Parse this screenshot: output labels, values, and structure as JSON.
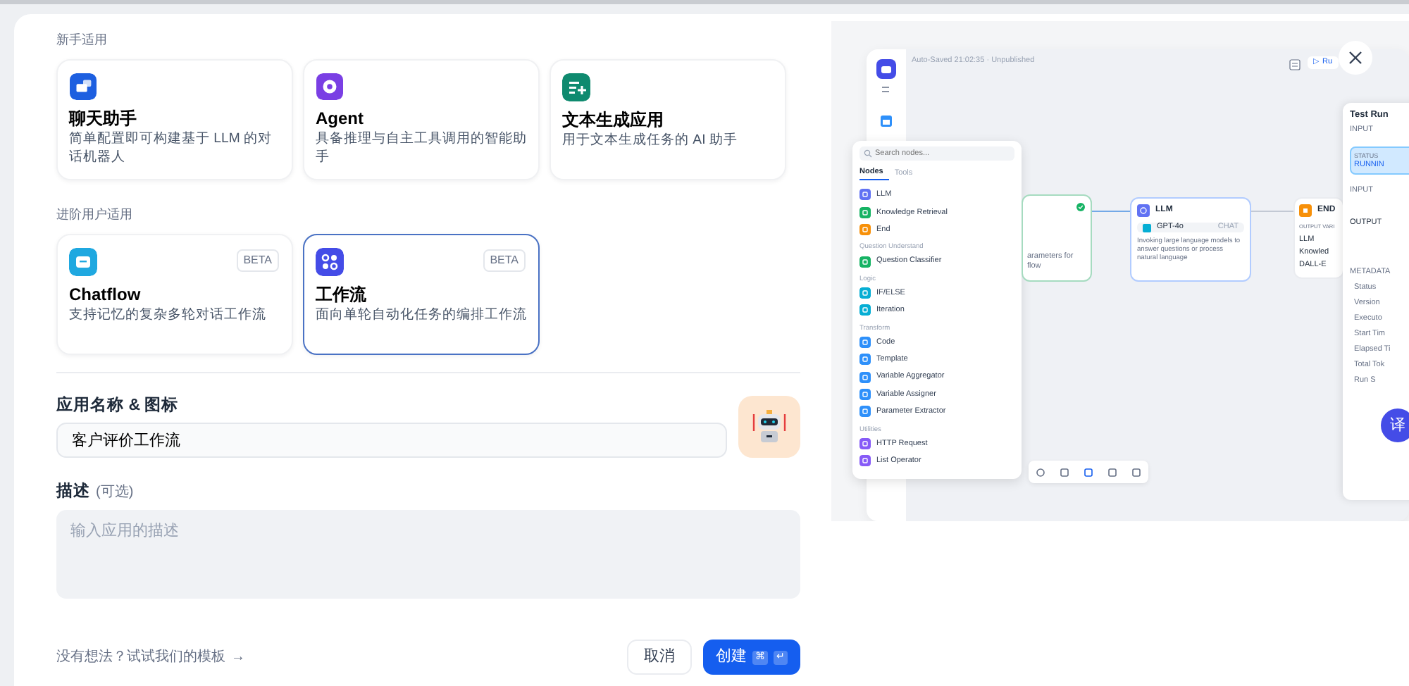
{
  "sections": [
    {
      "label": "新手适用",
      "apps": [
        {
          "title": "聊天助手",
          "description": "简单配置即可构建基于 LLM 的对话机器人",
          "color": "#1d5fe0",
          "selected": false
        },
        {
          "title": "Agent",
          "description": "具备推理与自主工具调用的智能助手",
          "color": "#7a3fe4",
          "selected": false
        },
        {
          "title": "文本生成应用",
          "description": "用于文本生成任务的 AI 助手",
          "color": "#0f8a6f",
          "selected": false
        }
      ]
    },
    {
      "label": "进阶用户适用",
      "apps": [
        {
          "title": "Chatflow",
          "description": "支持记忆的复杂多轮对话工作流",
          "badge": "BETA",
          "color": "#1fa8e0",
          "selected": false
        },
        {
          "title": "工作流",
          "description": "面向单轮自动化任务的编排工作流",
          "badge": "BETA",
          "color": "#444ce7",
          "selected": true
        }
      ]
    }
  ],
  "form": {
    "name_label": "应用名称 & 图标",
    "name_value": "客户评价工作流",
    "description_label": "描述",
    "description_optional": "(可选)",
    "description_placeholder": "输入应用的描述"
  },
  "footer": {
    "template_link": "没有想法？试试我们的模板",
    "arrow": "→",
    "cancel": "取消",
    "create": "创建",
    "shortcut": [
      "⌘",
      "↵"
    ]
  },
  "preview": {
    "header": "Auto-Saved 21:02:35 · Unpublished",
    "run_button": "▷ Ru",
    "node_panel": {
      "search_placeholder": "Search nodes...",
      "tabs": [
        {
          "label": "Nodes",
          "selected": true
        },
        {
          "label": "Tools",
          "selected": false
        }
      ],
      "groups": [
        {
          "items": [
            {
              "name": "LLM",
              "color": "#6172f3"
            },
            {
              "name": "Knowledge Retrieval",
              "color": "#16b364"
            },
            {
              "name": "End",
              "color": "#f79009"
            }
          ]
        },
        {
          "label": "Question Understand",
          "items": [
            {
              "name": "Question Classifier",
              "color": "#16b364"
            }
          ]
        },
        {
          "label": "Logic",
          "items": [
            {
              "name": "IF/ELSE",
              "color": "#06aed4"
            },
            {
              "name": "Iteration",
              "color": "#06aed4"
            }
          ]
        },
        {
          "label": "Transform",
          "items": [
            {
              "name": "Code",
              "color": "#2e90fa"
            },
            {
              "name": "Template",
              "color": "#2e90fa"
            },
            {
              "name": "Variable Aggregator",
              "color": "#2e90fa"
            },
            {
              "name": "Variable Assigner",
              "color": "#2e90fa"
            },
            {
              "name": "Parameter Extractor",
              "color": "#2e90fa"
            }
          ]
        },
        {
          "label": "Utilities",
          "items": [
            {
              "name": "HTTP Request",
              "color": "#875bf7"
            },
            {
              "name": "List Operator",
              "color": "#875bf7"
            }
          ]
        }
      ]
    },
    "start_node": {
      "lines": [
        "arameters for",
        "flow"
      ]
    },
    "llm_node": {
      "title": "LLM",
      "model": "GPT-4o",
      "mode": "CHAT",
      "description": "Invoking large language models to answer questions or process natural language"
    },
    "end_node": {
      "title": "END",
      "label": "OUTPUT VARI",
      "items": [
        "LLM",
        "Knowled",
        "DALL-E"
      ]
    },
    "test_run": {
      "title": "Test Run",
      "tab": "INPUT",
      "status_label": "STATUS",
      "status": "RUNNIN",
      "input_label": "INPUT",
      "output_label": "OUTPUT",
      "metadata_label": "METADATA",
      "metadata": [
        "Status",
        "Version",
        "Executo",
        "Start Tim",
        "Elapsed Ti",
        "Total Tok",
        "Run S"
      ]
    }
  },
  "translate_button": "译"
}
